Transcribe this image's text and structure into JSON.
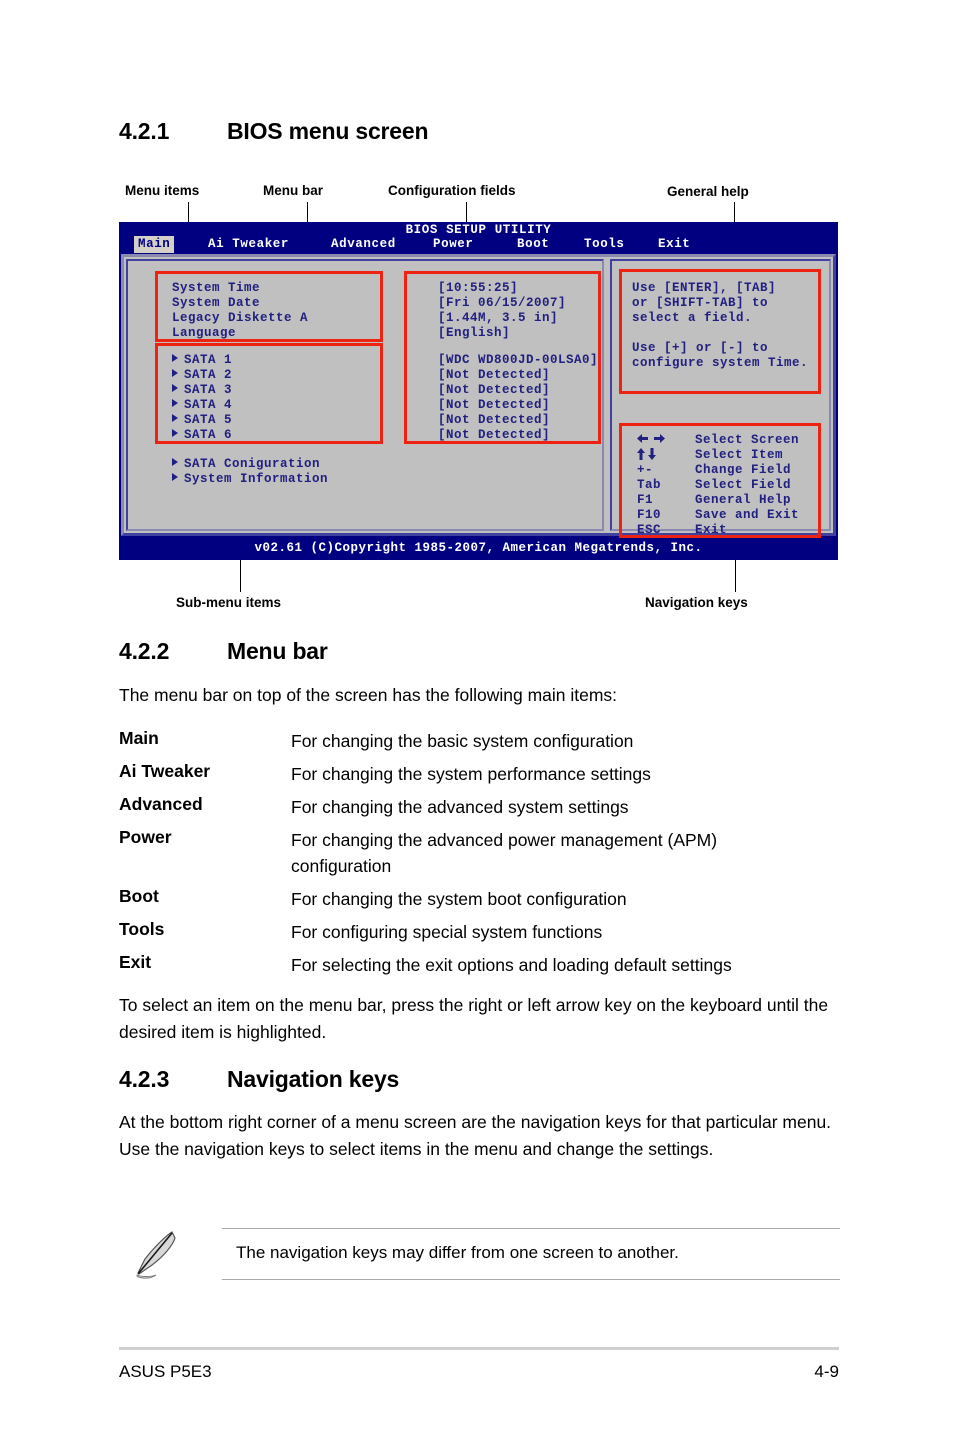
{
  "sections": {
    "s421": {
      "number": "4.2.1",
      "title": "BIOS menu screen"
    },
    "s422": {
      "number": "4.2.2",
      "title": "Menu bar"
    },
    "s423": {
      "number": "4.2.3",
      "title": "Navigation keys"
    }
  },
  "callouts": {
    "menu_items": "Menu items",
    "menu_bar": "Menu bar",
    "configuration_fields": "Configuration fields",
    "general_help": "General help",
    "sub_menu_items": "Sub-menu items",
    "navigation_keys": "Navigation keys"
  },
  "bios": {
    "title": "BIOS SETUP UTILITY",
    "menu_tabs": [
      {
        "label": "Main",
        "active": true
      },
      {
        "label": "Ai Tweaker",
        "active": false
      },
      {
        "label": "Advanced",
        "active": false
      },
      {
        "label": "Power",
        "active": false
      },
      {
        "label": "Boot",
        "active": false
      },
      {
        "label": "Tools",
        "active": false
      },
      {
        "label": "Exit",
        "active": false
      }
    ],
    "menu_items": [
      {
        "label": "System Time",
        "value": "[10:55:25]",
        "submenu": false
      },
      {
        "label": "System Date",
        "value": "[Fri 06/15/2007]",
        "submenu": false
      },
      {
        "label": "Legacy Diskette A",
        "value": "[1.44M, 3.5 in]",
        "submenu": false
      },
      {
        "label": "Language",
        "value": "[English]",
        "submenu": false
      }
    ],
    "sata_items": [
      {
        "label": "SATA 1",
        "value": "[WDC WD800JD-00LSA0]",
        "submenu": true
      },
      {
        "label": "SATA 2",
        "value": "[Not Detected]",
        "submenu": true
      },
      {
        "label": "SATA 3",
        "value": "[Not Detected]",
        "submenu": true
      },
      {
        "label": "SATA 4",
        "value": "[Not Detected]",
        "submenu": true
      },
      {
        "label": "SATA 5",
        "value": "[Not Detected]",
        "submenu": true
      },
      {
        "label": "SATA 6",
        "value": "[Not Detected]",
        "submenu": true
      }
    ],
    "extra_items": [
      {
        "label": "SATA Coniguration",
        "submenu": true
      },
      {
        "label": "System Information",
        "submenu": true
      }
    ],
    "general_help": [
      "Use [ENTER], [TAB]",
      "or [SHIFT-TAB] to",
      "select a field.",
      "",
      "Use [+] or [-] to",
      "configure system Time."
    ],
    "navigation_keys": [
      {
        "key": "←→",
        "desc": "Select Screen",
        "icon": "left-right-arrow-icon"
      },
      {
        "key": "↑↓",
        "desc": "Select Item",
        "icon": "up-down-arrow-icon"
      },
      {
        "key": "+-",
        "desc": "Change Field",
        "icon": null
      },
      {
        "key": "Tab",
        "desc": "Select Field",
        "icon": null
      },
      {
        "key": "F1",
        "desc": "General Help",
        "icon": null
      },
      {
        "key": "F10",
        "desc": "Save and Exit",
        "icon": null
      },
      {
        "key": "ESC",
        "desc": "Exit",
        "icon": null
      }
    ],
    "copyright": "v02.61 (C)Copyright 1985-2007, American Megatrends, Inc.",
    "colors": {
      "title_bar": "#000080",
      "panel": "#c0c0c0",
      "text": "#202080",
      "annotation": "#ee2211",
      "active_tab_bg": "#d4d0c8"
    }
  },
  "menu_bar_section": {
    "intro": "The menu bar on top of the screen has the following main items:",
    "entries": [
      {
        "term": "Main",
        "desc": "For changing the basic system configuration"
      },
      {
        "term": "Ai Tweaker",
        "desc": "For changing the system performance settings"
      },
      {
        "term": "Advanced",
        "desc": "For changing the advanced system settings"
      },
      {
        "term": "Power",
        "desc": "For changing the advanced power management (APM) configuration"
      },
      {
        "term": "Boot",
        "desc": "For changing the system boot configuration"
      },
      {
        "term": "Tools",
        "desc": "For configuring special system functions"
      },
      {
        "term": "Exit",
        "desc": "For selecting the exit options and loading default settings"
      }
    ],
    "outro": "To select an item on the menu bar, press the right or left arrow key on the keyboard until the desired item is highlighted."
  },
  "navigation_keys_section": {
    "body": "At the bottom right corner of a menu screen are the navigation keys for that particular menu. Use the navigation keys to select items in the menu and change the settings."
  },
  "note": {
    "text": "The navigation keys may differ from one screen to another.",
    "icon": "note-pencil-icon"
  },
  "footer": {
    "left": "ASUS P5E3",
    "right": "4-9"
  }
}
